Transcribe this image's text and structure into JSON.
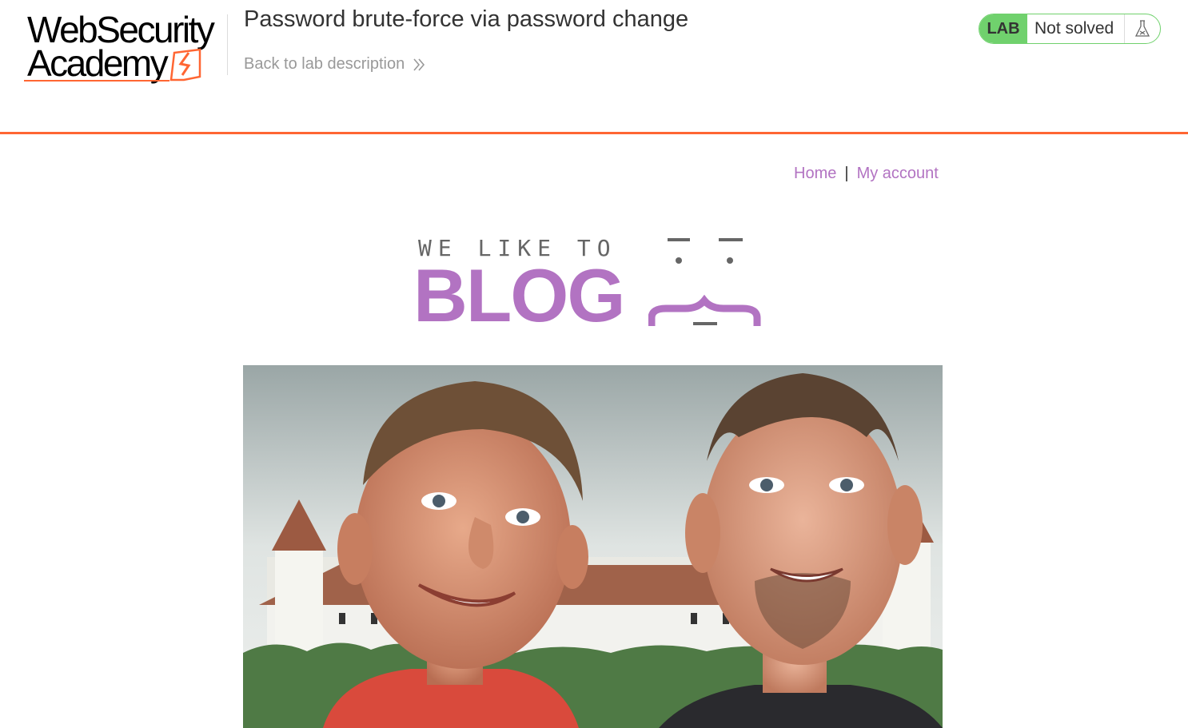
{
  "header": {
    "logo": {
      "line1": "WebSecurity",
      "line2": "Academy"
    },
    "lab_title": "Password brute-force via password change",
    "back_link": "Back to lab description",
    "status": {
      "badge": "LAB",
      "text": "Not solved",
      "icon": "flask-icon"
    }
  },
  "nav": {
    "home": "Home",
    "separator": "|",
    "account": "My account"
  },
  "blog_logo": {
    "tagline": "WE LIKE TO",
    "word": "BLOG"
  },
  "hero": {
    "icon": "hero-banner-photo"
  },
  "colors": {
    "accent_orange": "#ff6633",
    "status_green": "#70d16d",
    "link_purple": "#b273c2"
  }
}
